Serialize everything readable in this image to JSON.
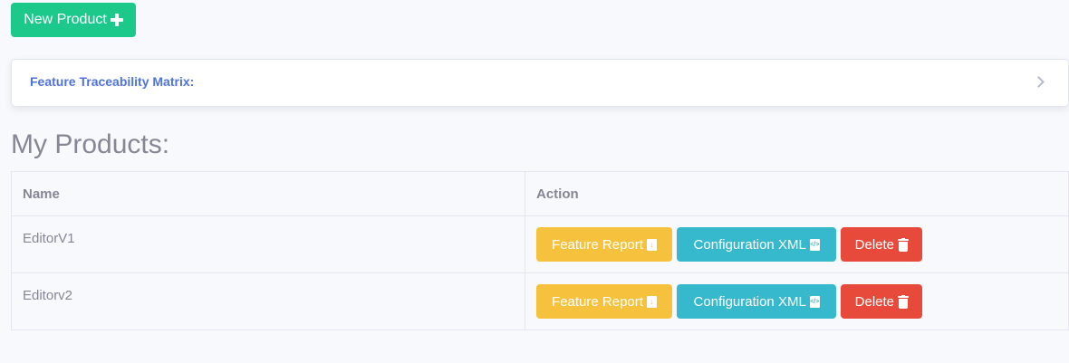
{
  "toolbar": {
    "new_product_label": "New Product"
  },
  "traceability_card": {
    "title": "Feature Traceability Matrix:"
  },
  "products_section": {
    "title": "My Products:",
    "columns": [
      "Name",
      "Action"
    ],
    "rows": [
      {
        "name": "EditorV1",
        "feature_report_label": "Feature Report",
        "config_xml_label": "Configuration XML",
        "delete_label": "Delete"
      },
      {
        "name": "Editorv2",
        "feature_report_label": "Feature Report",
        "config_xml_label": "Configuration XML",
        "delete_label": "Delete"
      }
    ]
  },
  "colors": {
    "success": "#1cc88a",
    "primary": "#4e73df",
    "warning": "#f6c23e",
    "info": "#36b9cc",
    "danger": "#e74a3b",
    "text_muted": "#858796"
  },
  "icons": {
    "new_product": "plus-icon",
    "feature_report": "file-download-icon",
    "config_xml": "file-code-icon",
    "delete": "trash-icon",
    "card_toggle": "chevron-right-icon"
  }
}
